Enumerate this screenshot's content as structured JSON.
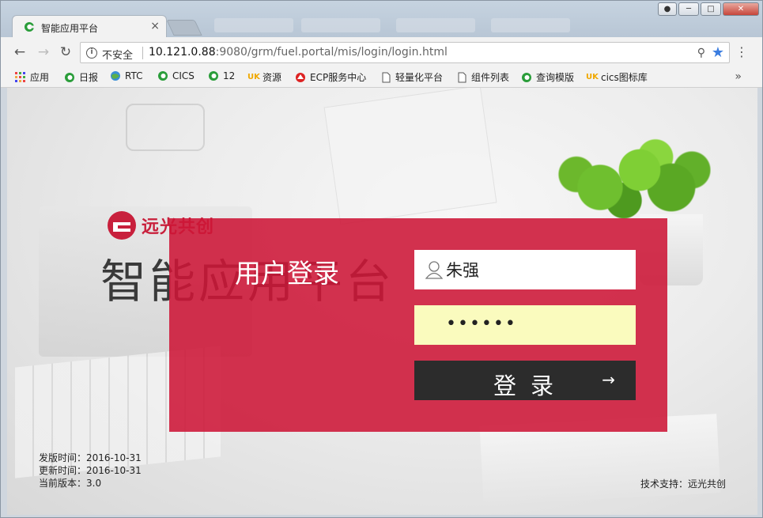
{
  "browser": {
    "tab": {
      "title": "智能应用平台",
      "close": "×"
    },
    "address": {
      "security_label": "不安全",
      "url_host": "10.121.0.88",
      "url_rest": ":9080/grm/fuel.portal/mis/login/login.html"
    },
    "bookmarks": [
      {
        "label": "应用",
        "icon": "apps-grid-icon"
      },
      {
        "label": "日报",
        "icon": "c-logo-icon"
      },
      {
        "label": "RTC",
        "icon": "globe-icon"
      },
      {
        "label": "CICS",
        "icon": "c-logo-icon"
      },
      {
        "label": "12",
        "icon": "c-logo-icon"
      },
      {
        "label": "资源",
        "icon": "uk-logo-icon"
      },
      {
        "label": "ECP服务中心",
        "icon": "ecp-logo-icon"
      },
      {
        "label": "轻量化平台",
        "icon": "page-icon"
      },
      {
        "label": "组件列表",
        "icon": "page-icon"
      },
      {
        "label": "查询模版",
        "icon": "c-logo-icon"
      },
      {
        "label": "cics图标库",
        "icon": "uk-logo-icon"
      }
    ],
    "bookmarks_more": "»"
  },
  "page": {
    "brand": "远光共创",
    "platform_title": "智能应用平台",
    "login": {
      "title": "用户登录",
      "username": "朱强",
      "password_mask": "••••••",
      "submit_label": "登录"
    },
    "release": {
      "publish": "发版时间：2016-10-31",
      "update": "更新时间：2016-10-31",
      "version": "当前版本：3.0"
    },
    "support": "技术支持：远光共创"
  },
  "colors": {
    "login_box": "#cd1637",
    "login_button": "#2c2c2c",
    "password_bg": "#fafbbe",
    "brand_red": "#c8203c",
    "star": "#3b7de0"
  }
}
